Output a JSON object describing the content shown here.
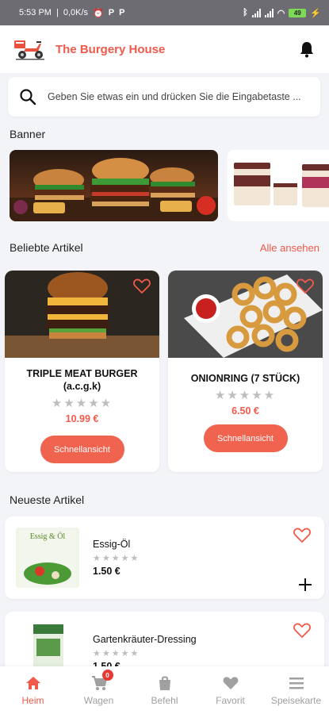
{
  "status_bar": {
    "time": "5:53 PM",
    "speed": "0,0K/s",
    "battery": "49"
  },
  "app_bar": {
    "title": "The Burgery House",
    "logo_icon": "delivery-scooter-logo",
    "notification_icon": "bell-icon"
  },
  "search": {
    "placeholder": "Geben Sie etwas ein und drücken Sie die Eingabetaste ..."
  },
  "banner_section": {
    "title": "Banner"
  },
  "popular": {
    "title": "Beliebte Artikel",
    "see_all": "Alle ansehen",
    "items": [
      {
        "name": "TRIPLE MEAT BURGER (a.c.g.k)",
        "rating": 0,
        "max_rating": 5,
        "stars": "★★★★★",
        "price": "10.99 €",
        "button": "Schnellansicht"
      },
      {
        "name": "ONIONRING (7 STÜCK)",
        "rating": 0,
        "max_rating": 5,
        "stars": "★★★★★",
        "price": "6.50 €",
        "button": "Schnellansicht"
      }
    ]
  },
  "newest": {
    "title": "Neueste Artikel",
    "items": [
      {
        "name": "Essig-Öl",
        "stars": "★★★★★",
        "price": "1.50 €",
        "thumb_label": "Essig & Öl"
      },
      {
        "name": "Gartenkräuter-Dressing",
        "stars": "★★★★★",
        "price": "1.50 €"
      }
    ]
  },
  "bottom_nav": {
    "items": [
      {
        "label": "Heim",
        "icon": "home-icon",
        "active": true
      },
      {
        "label": "Wagen",
        "icon": "cart-icon",
        "badge": "0"
      },
      {
        "label": "Befehl",
        "icon": "shopping-bag-icon"
      },
      {
        "label": "Favorit",
        "icon": "heart-icon"
      },
      {
        "label": "Speisekarte",
        "icon": "menu-icon"
      }
    ]
  },
  "colors": {
    "accent": "#f05a4a",
    "button": "#f0634f",
    "background": "#f3f4f8",
    "statusbar": "#6c6c72"
  }
}
